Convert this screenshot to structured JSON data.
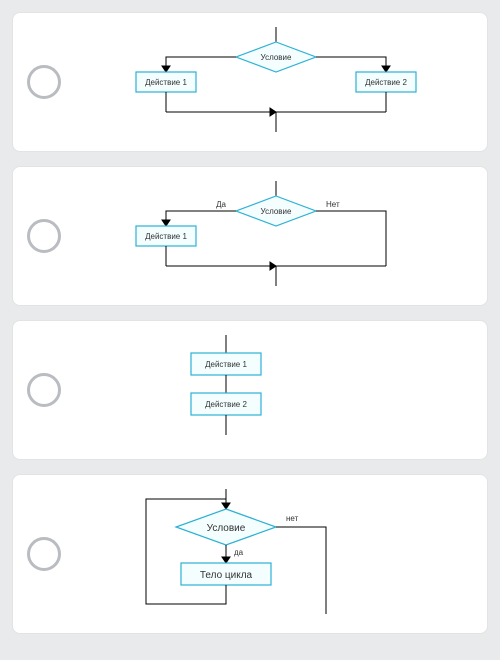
{
  "options": [
    {
      "condition": "Условие",
      "action1": "Действие 1",
      "action2": "Действие 2"
    },
    {
      "condition": "Условие",
      "yes": "Да",
      "no": "Нет",
      "action1": "Действие 1"
    },
    {
      "action1": "Действие 1",
      "action2": "Действие 2"
    },
    {
      "condition": "Условие",
      "yes": "да",
      "no": "нет",
      "body": "Тело цикла"
    }
  ]
}
